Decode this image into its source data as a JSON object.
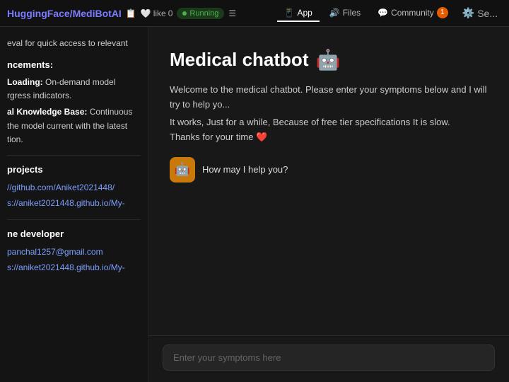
{
  "topbar": {
    "brand_prefix": "HuggingFace/",
    "brand_name": "MediBotAI",
    "like_label": "like",
    "like_count": "0",
    "running_label": "Running",
    "nav_tabs": [
      {
        "id": "app",
        "label": "App",
        "active": true,
        "icon": "📱"
      },
      {
        "id": "files",
        "label": "Files",
        "active": false,
        "icon": "🔊"
      },
      {
        "id": "community",
        "label": "Community",
        "active": false,
        "icon": "💬",
        "badge": "1"
      },
      {
        "id": "settings",
        "label": "Se...",
        "active": false,
        "icon": "⚙️"
      }
    ]
  },
  "sidebar": {
    "intro_text": "eval for quick access to relevant",
    "section_enhancements": "ncements:",
    "item1_title": "Loading:",
    "item1_text": "On-demand model rgress indicators.",
    "item2_title": "al Knowledge Base:",
    "item2_text": "Continuous the model current with the latest tion.",
    "section_projects": "projects",
    "project_links": [
      "//github.com/Aniket2021448/",
      "s://aniket2021448.github.io/My-"
    ],
    "section_developer": "ne developer",
    "dev_email": "panchal1257@gmail.com",
    "dev_link": "s://aniket2021448.github.io/My-"
  },
  "chat": {
    "title": "Medical chatbot",
    "title_emoji": "🤖",
    "welcome_text": "Welcome to the medical chatbot. Please enter your symptoms below and I will try to help yo...",
    "info_text": "It works, Just for a while, Because of free tier specifications It is slow.",
    "thanks_text": "Thanks for your time",
    "thanks_emoji": "❤️",
    "bot_message": "How may I help you?",
    "input_placeholder": "Enter your symptoms here"
  },
  "icons": {
    "heart_icon": "🤍",
    "robot_icon": "🤖",
    "app_icon": "📱",
    "files_icon": "🔊",
    "community_icon": "💬",
    "settings_icon": "⚙️",
    "list_icon": "☰",
    "copy_icon": "📋",
    "bot_face": "🤖"
  }
}
